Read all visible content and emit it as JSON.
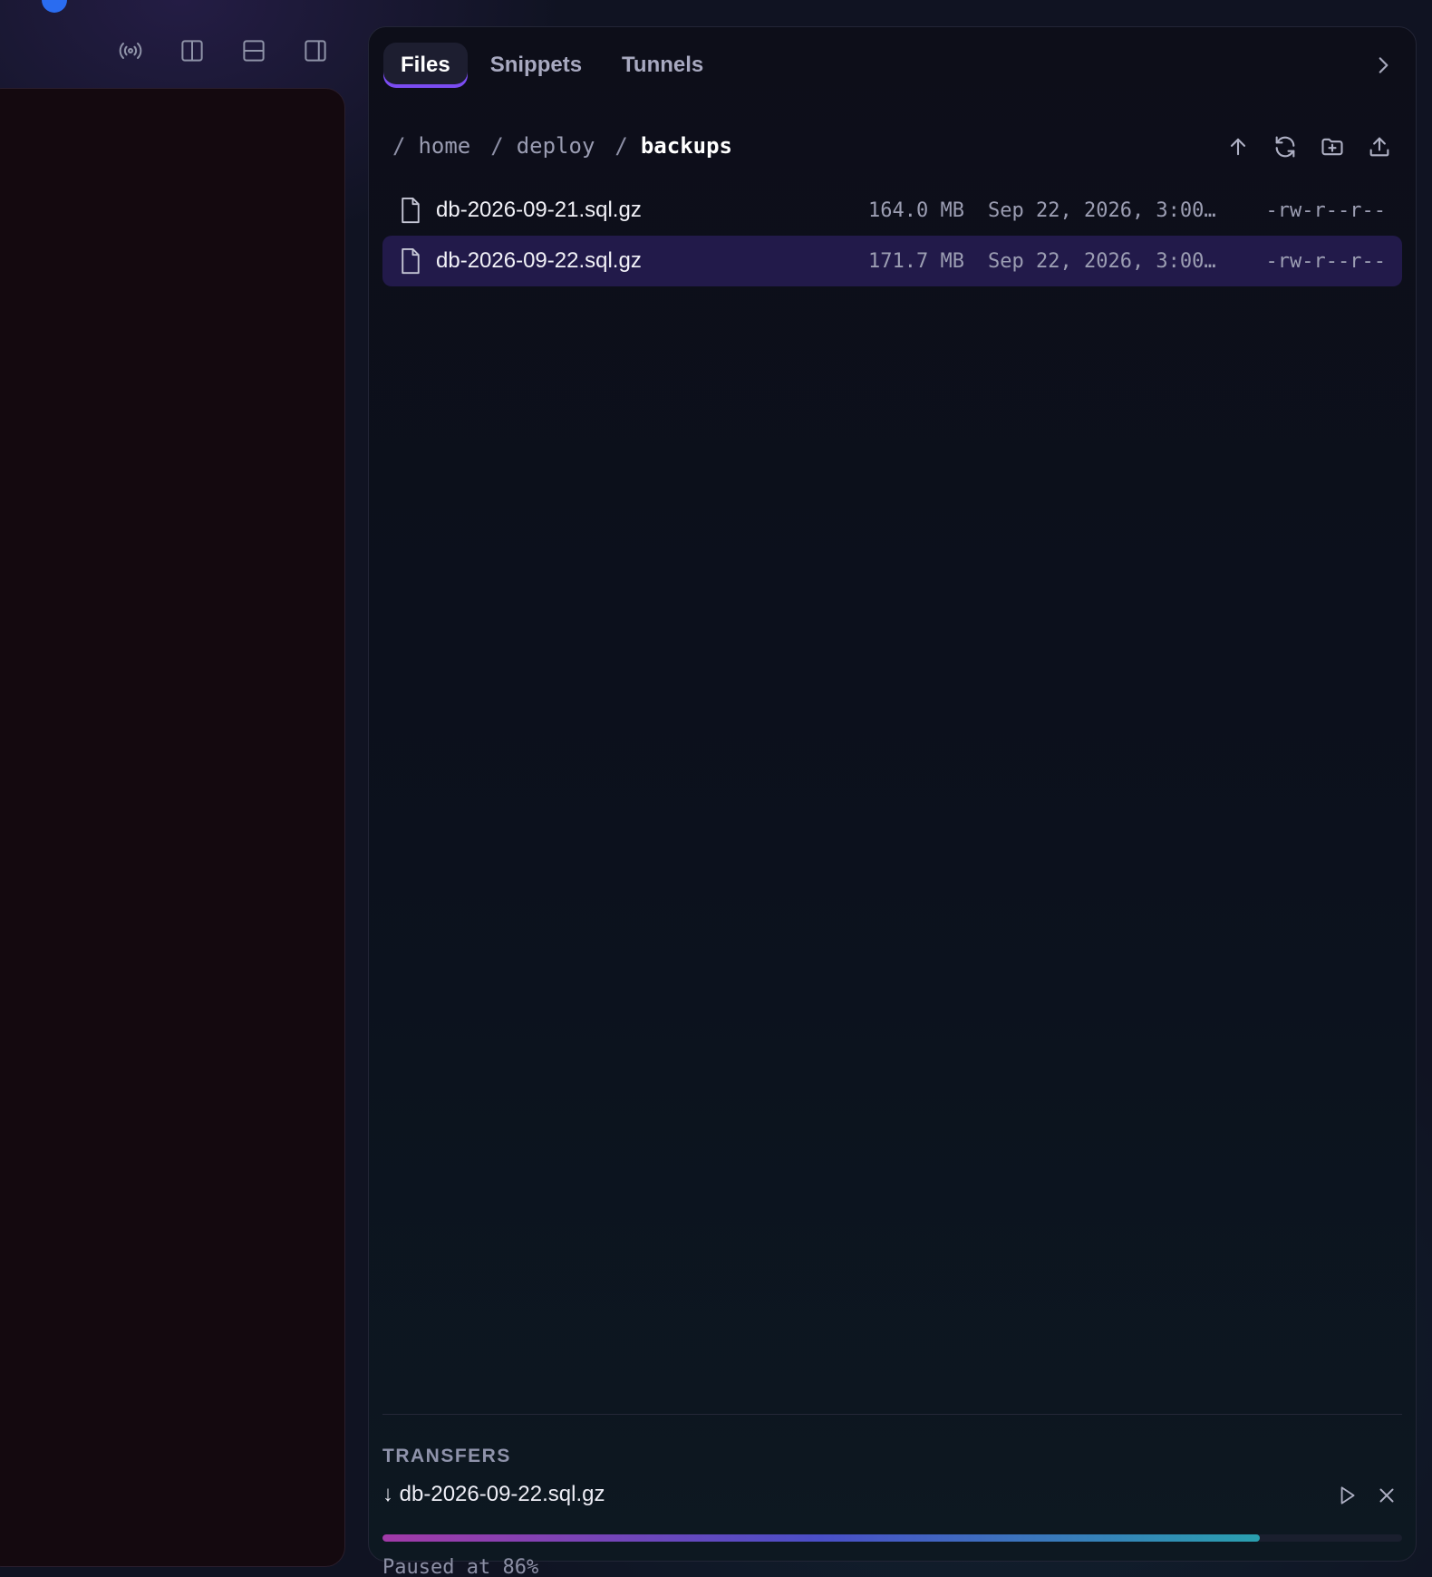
{
  "toolbar": {
    "icons": [
      "broadcast-icon",
      "split-vertical-icon",
      "split-horizontal-icon",
      "sidebar-right-icon"
    ]
  },
  "panel": {
    "tabs": [
      {
        "label": "Files",
        "active": true
      },
      {
        "label": "Snippets",
        "active": false
      },
      {
        "label": "Tunnels",
        "active": false
      }
    ],
    "collapse_icon": "chevron-right-icon"
  },
  "breadcrumb": {
    "root": "/",
    "segments": [
      "home",
      "deploy",
      "backups"
    ],
    "separator": "/"
  },
  "path_actions": [
    "arrow-up-icon",
    "refresh-icon",
    "new-folder-icon",
    "upload-icon"
  ],
  "files": [
    {
      "name": "db-2026-09-21.sql.gz",
      "size": "164.0 MB",
      "modified": "Sep 22, 2026, 3:00…",
      "perms": "-rw-r--r--",
      "selected": false
    },
    {
      "name": "db-2026-09-22.sql.gz",
      "size": "171.7 MB",
      "modified": "Sep 22, 2026, 3:00…",
      "perms": "-rw-r--r--",
      "selected": true
    }
  ],
  "transfers": {
    "title": "TRANSFERS",
    "items": [
      {
        "direction_glyph": "↓",
        "name": "db-2026-09-22.sql.gz",
        "display": "↓ db-2026-09-22.sql.gz",
        "progress": 0.86,
        "status": "Paused at 86%"
      }
    ]
  },
  "colors": {
    "accent": "#7b4cf2",
    "selected_row": "#221a4a",
    "progress_start": "#a23aa8",
    "progress_end": "#2aa0b0"
  }
}
